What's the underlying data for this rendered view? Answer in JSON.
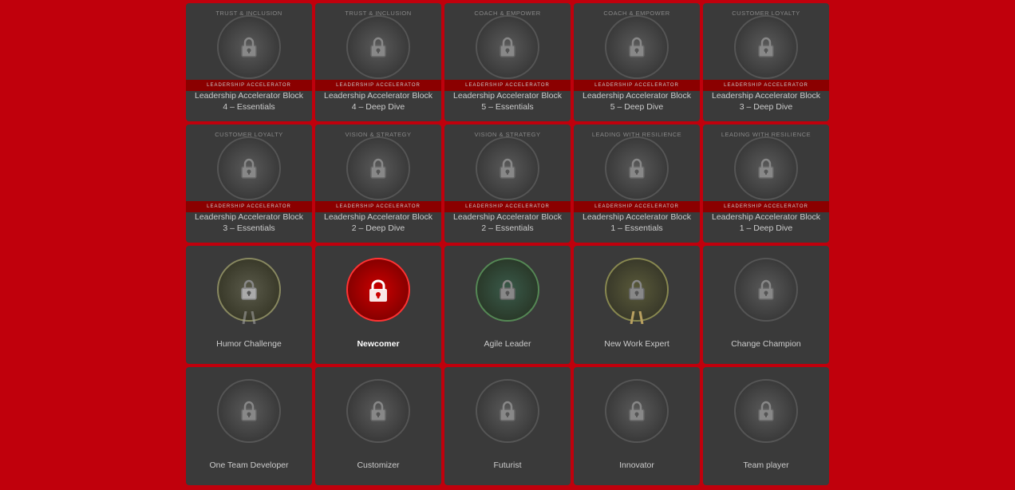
{
  "cards": [
    {
      "id": "card-1",
      "label": "Leadership Accelerator Block\n4 – Essentials",
      "overlay": "TRUST &\nINCLUSION",
      "type": "locked",
      "ribbon": true
    },
    {
      "id": "card-2",
      "label": "Leadership Accelerator Block\n4 – Deep Dive",
      "overlay": "TRUST &\nINCLUSION",
      "type": "locked",
      "ribbon": true
    },
    {
      "id": "card-3",
      "label": "Leadership Accelerator Block\n5 – Essentials",
      "overlay": "COACH &\nEMPOWER",
      "type": "locked",
      "ribbon": true
    },
    {
      "id": "card-4",
      "label": "Leadership Accelerator Block\n5 – Deep Dive",
      "overlay": "COACH &\nEMPOWER",
      "type": "locked",
      "ribbon": true
    },
    {
      "id": "card-5",
      "label": "Leadership Accelerator Block\n3 – Deep Dive",
      "overlay": "CUSTOMER\nLOYALTY",
      "type": "locked",
      "ribbon": true
    },
    {
      "id": "card-6",
      "label": "Leadership Accelerator Block\n3 – Essentials",
      "overlay": "CUSTOMER\nLOYALTY",
      "type": "locked",
      "ribbon": true
    },
    {
      "id": "card-7",
      "label": "Leadership Accelerator Block\n2 – Deep Dive",
      "overlay": "VISION &\nSTRATEGY",
      "type": "locked",
      "ribbon": true
    },
    {
      "id": "card-8",
      "label": "Leadership Accelerator Block\n2 – Essentials",
      "overlay": "VISION &\nSTRATEGY",
      "type": "locked",
      "ribbon": true
    },
    {
      "id": "card-9",
      "label": "Leadership Accelerator Block\n1 – Essentials",
      "overlay": "LEADING WITH\nRESILIENCE",
      "type": "locked",
      "ribbon": true
    },
    {
      "id": "card-10",
      "label": "Leadership Accelerator Block\n1 – Deep Dive",
      "overlay": "LEADING WITH\nRESILIENCE",
      "type": "locked",
      "ribbon": true
    },
    {
      "id": "card-11",
      "label": "Humor Challenge",
      "overlay": "",
      "type": "humor",
      "ribbon": false
    },
    {
      "id": "card-12",
      "label": "Newcomer",
      "overlay": "",
      "type": "newcomer",
      "ribbon": false
    },
    {
      "id": "card-13",
      "label": "Agile Leader",
      "overlay": "",
      "type": "agile",
      "ribbon": false
    },
    {
      "id": "card-14",
      "label": "New Work Expert",
      "overlay": "",
      "type": "new-work",
      "ribbon": false
    },
    {
      "id": "card-15",
      "label": "Change Champion",
      "overlay": "",
      "type": "locked",
      "ribbon": false
    },
    {
      "id": "card-16",
      "label": "One Team Developer",
      "overlay": "",
      "type": "locked",
      "ribbon": false
    },
    {
      "id": "card-17",
      "label": "Customizer",
      "overlay": "",
      "type": "locked",
      "ribbon": false
    },
    {
      "id": "card-18",
      "label": "Futurist",
      "overlay": "",
      "type": "locked",
      "ribbon": false
    },
    {
      "id": "card-19",
      "label": "Innovator",
      "overlay": "",
      "type": "locked",
      "ribbon": false
    },
    {
      "id": "card-20",
      "label": "Team player",
      "overlay": "",
      "type": "locked",
      "ribbon": false
    }
  ]
}
